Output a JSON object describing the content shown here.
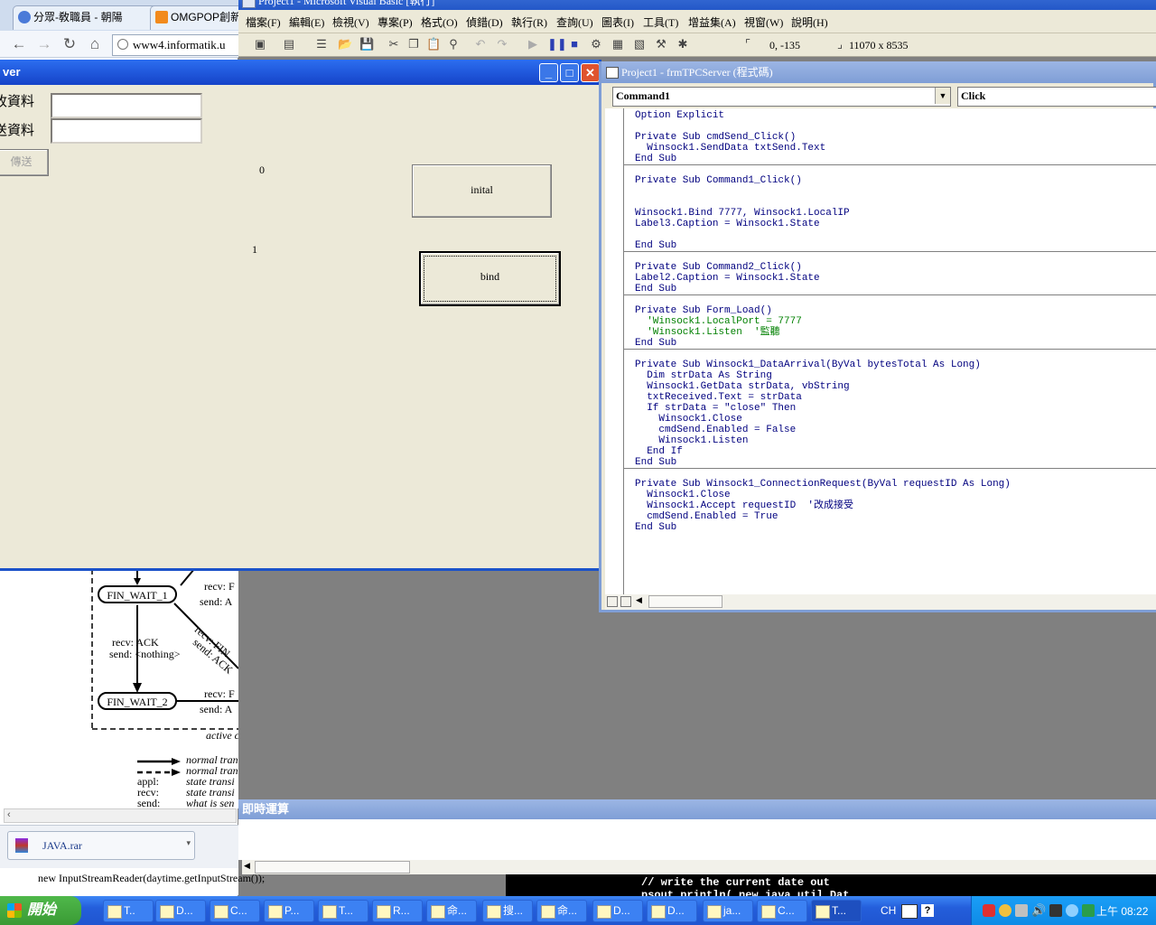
{
  "browser": {
    "tabs": [
      {
        "label": "分眾-敎職員 - 朝陽"
      },
      {
        "label": "OMGPOP創新"
      }
    ],
    "tab_close": "×",
    "address": "www4.informatik.u",
    "download_file": "JAVA.rar",
    "bottom_code": "new InputStreamReader(daytime.getInputStream());"
  },
  "diagram": {
    "states": [
      "FIN_WAIT_1",
      "FIN_WAIT_2"
    ],
    "edge_labels": [
      {
        "line1": "recv: ACK",
        "line2": "send: <nothing>"
      },
      {
        "line1": "recv: F",
        "line2": "send: A"
      },
      {
        "line1": "recv: FIN",
        "line2": "send: ACK"
      },
      {
        "line1": "recv: F",
        "line2": "send: A"
      }
    ],
    "active_label": "active c",
    "legend": [
      {
        "key": "",
        "text": "normal tran"
      },
      {
        "key": "",
        "text": "normal tran"
      },
      {
        "key": "appl:",
        "text": "state transi"
      },
      {
        "key": "recv:",
        "text": "state transi"
      },
      {
        "key": "send:",
        "text": "what is sen"
      }
    ]
  },
  "vb": {
    "title": "Project1 - Microsoft Visual Basic [執行]",
    "menu": [
      "檔案(F)",
      "編輯(E)",
      "檢視(V)",
      "專案(P)",
      "格式(O)",
      "偵錯(D)",
      "執行(R)",
      "查詢(U)",
      "圖表(I)",
      "工具(T)",
      "增益集(A)",
      "視窗(W)",
      "說明(H)"
    ],
    "toolbar": {
      "position": "0, -135",
      "size": "11070 x 8535"
    }
  },
  "form": {
    "title": "ver",
    "label_receive": "收資料",
    "label_send": "送資料",
    "send_button": "傳送",
    "label3": "0",
    "label2": "1",
    "command1": "inital",
    "command2": "bind"
  },
  "code_window": {
    "title": "Project1 - frmTPCServer (程式碼)",
    "object_combo": "Command1",
    "proc_combo": "Click",
    "lines": [
      {
        "text": "Option Explicit",
        "green": false
      },
      {
        "text": "",
        "green": false
      },
      {
        "text": "Private Sub cmdSend_Click()",
        "green": false
      },
      {
        "text": "  Winsock1.SendData txtSend.Text",
        "green": false
      },
      {
        "text": "End Sub",
        "green": false
      },
      {
        "text": "",
        "green": false
      },
      {
        "text": "Private Sub Command1_Click()",
        "green": false
      },
      {
        "text": "",
        "green": false
      },
      {
        "text": "",
        "green": false
      },
      {
        "text": "Winsock1.Bind 7777, Winsock1.LocalIP",
        "green": false
      },
      {
        "text": "Label3.Caption = Winsock1.State",
        "green": false
      },
      {
        "text": "",
        "green": false
      },
      {
        "text": "End Sub",
        "green": false
      },
      {
        "text": "",
        "green": false
      },
      {
        "text": "Private Sub Command2_Click()",
        "green": false
      },
      {
        "text": "Label2.Caption = Winsock1.State",
        "green": false
      },
      {
        "text": "End Sub",
        "green": false
      },
      {
        "text": "",
        "green": false
      },
      {
        "text": "Private Sub Form_Load()",
        "green": false
      },
      {
        "text": "  'Winsock1.LocalPort = 7777",
        "green": true
      },
      {
        "text": "  'Winsock1.Listen  '監聽",
        "green": true
      },
      {
        "text": "End Sub",
        "green": false
      },
      {
        "text": "",
        "green": false
      },
      {
        "text": "Private Sub Winsock1_DataArrival(ByVal bytesTotal As Long)",
        "green": false
      },
      {
        "text": "  Dim strData As String",
        "green": false
      },
      {
        "text": "  Winsock1.GetData strData, vbString",
        "green": false
      },
      {
        "text": "  txtReceived.Text = strData",
        "green": false
      },
      {
        "text": "  If strData = \"close\" Then",
        "green": false
      },
      {
        "text": "    Winsock1.Close",
        "green": false
      },
      {
        "text": "    cmdSend.Enabled = False",
        "green": false
      },
      {
        "text": "    Winsock1.Listen",
        "green": false
      },
      {
        "text": "  End If",
        "green": false
      },
      {
        "text": "End Sub",
        "green": false
      },
      {
        "text": "",
        "green": false
      },
      {
        "text": "Private Sub Winsock1_ConnectionRequest(ByVal requestID As Long)",
        "green": false
      },
      {
        "text": "  Winsock1.Close",
        "green": false
      },
      {
        "text": "  Winsock1.Accept requestID  '改成接受",
        "green": false
      },
      {
        "text": "  cmdSend.Enabled = True",
        "green": false
      },
      {
        "text": "End Sub",
        "green": false
      }
    ],
    "separators_after_line": [
      5,
      13,
      17,
      22,
      33
    ]
  },
  "immediate": {
    "title": "即時運算"
  },
  "console": {
    "line1": "// write the current date out",
    "line2": "psout.println( new java.util.Dat"
  },
  "taskbar": {
    "start_label": "開始",
    "tasks": [
      "T..",
      "D...",
      "C...",
      "P...",
      "T...",
      "R...",
      "命...",
      "搜...",
      "命...",
      "D...",
      "D...",
      "ja...",
      "C...",
      "T..."
    ],
    "lang": "CH",
    "clock": "上午 08:22"
  },
  "colors": {
    "accent": "#1b52c9",
    "form_bg": "#ece9d8",
    "code_keyword": "#00007f",
    "code_comment": "#008000"
  }
}
